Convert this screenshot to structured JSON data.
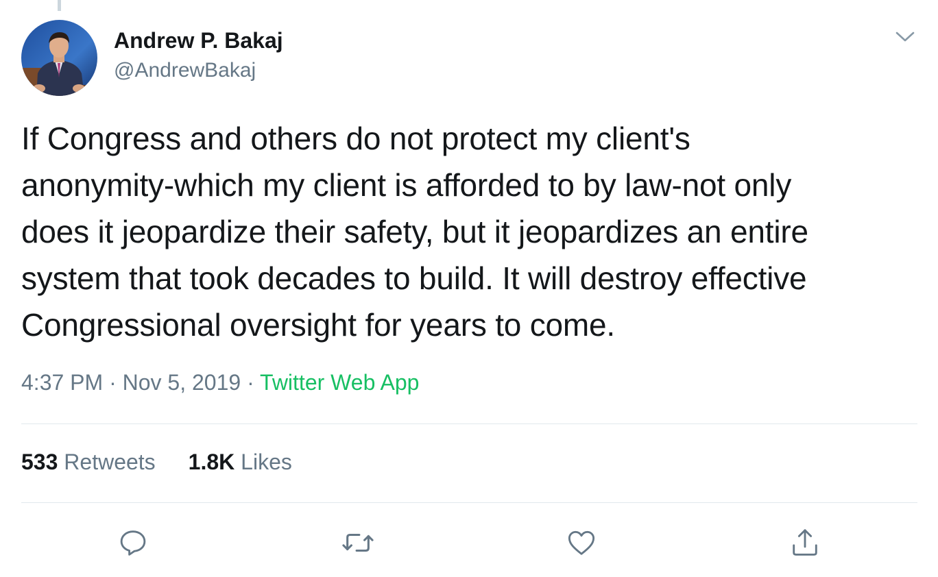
{
  "tweet": {
    "author_name": "Andrew P. Bakaj",
    "author_handle": "@AndrewBakaj",
    "text_lines": [
      "If Congress and others do not protect my client's",
      "anonymity-which my client is afforded to by law-not only",
      "does it jeopardize their safety, but it jeopardizes an entire",
      "system that took decades to build. It will destroy effective",
      "Congressional oversight for years to come."
    ],
    "time": "4:37 PM",
    "separator": " · ",
    "date": "Nov 5, 2019",
    "source": "Twitter Web App"
  },
  "stats": {
    "retweets_count": "533",
    "retweets_label": "Retweets",
    "likes_count": "1.8K",
    "likes_label": "Likes"
  },
  "icons": {
    "caret": "chevron-down-icon",
    "reply": "reply-icon",
    "retweet": "retweet-icon",
    "like": "heart-icon",
    "share": "share-icon"
  },
  "colors": {
    "text": "#14171a",
    "secondary": "#657786",
    "source_link": "#17bf63",
    "divider": "#e1e8ed"
  }
}
